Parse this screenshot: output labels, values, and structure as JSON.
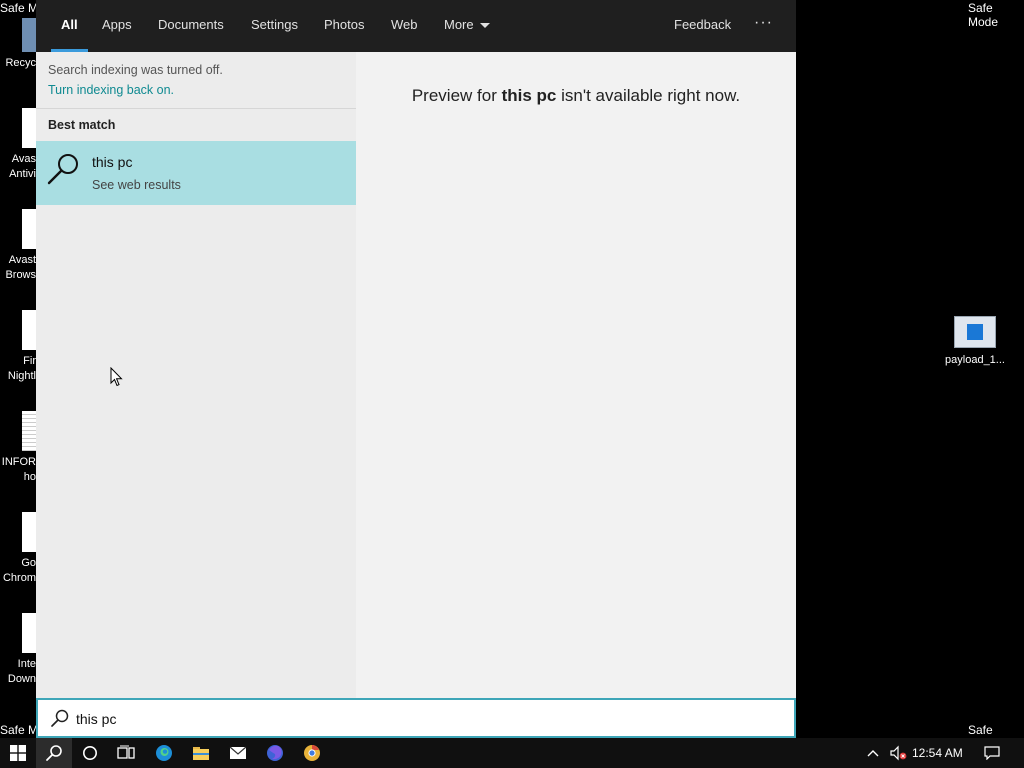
{
  "desktop": {
    "safe_mode_label": "Safe Mode",
    "safe_mode_left_top": "Safe M",
    "safe_mode_left_bottom": "Safe M",
    "icons": [
      {
        "line1": "Recyc",
        "line2": ""
      },
      {
        "line1": "Avas",
        "line2": "Antivi"
      },
      {
        "line1": "Avast",
        "line2": "Brows"
      },
      {
        "line1": "Fir",
        "line2": "Nightl"
      },
      {
        "line1": "INFOR",
        "line2": "ho"
      },
      {
        "line1": "Go",
        "line2": "Chrom"
      },
      {
        "line1": "Inte",
        "line2": "Down"
      }
    ],
    "payload_label": "payload_1..."
  },
  "search": {
    "tabs": [
      "All",
      "Apps",
      "Documents",
      "Settings",
      "Photos",
      "Web",
      "More"
    ],
    "feedback": "Feedback",
    "more_options": "···",
    "indexing_msg": "Search indexing was turned off.",
    "indexing_link": "Turn indexing back on.",
    "best_match_label": "Best match",
    "result": {
      "title": "this pc",
      "subtitle": "See web results"
    },
    "preview": {
      "prefix": "Preview for ",
      "query": "this pc",
      "suffix": " isn't available right now."
    },
    "query": "this pc",
    "accent": "#3b9bdc",
    "selection_color": "#a9dee2"
  },
  "taskbar": {
    "icons": [
      "windows-start-icon",
      "search-icon",
      "cortana-icon",
      "task-view-icon",
      "edge-icon",
      "file-explorer-icon",
      "mail-icon",
      "firefox-icon",
      "chrome-icon"
    ],
    "clock": "12:54 AM"
  }
}
